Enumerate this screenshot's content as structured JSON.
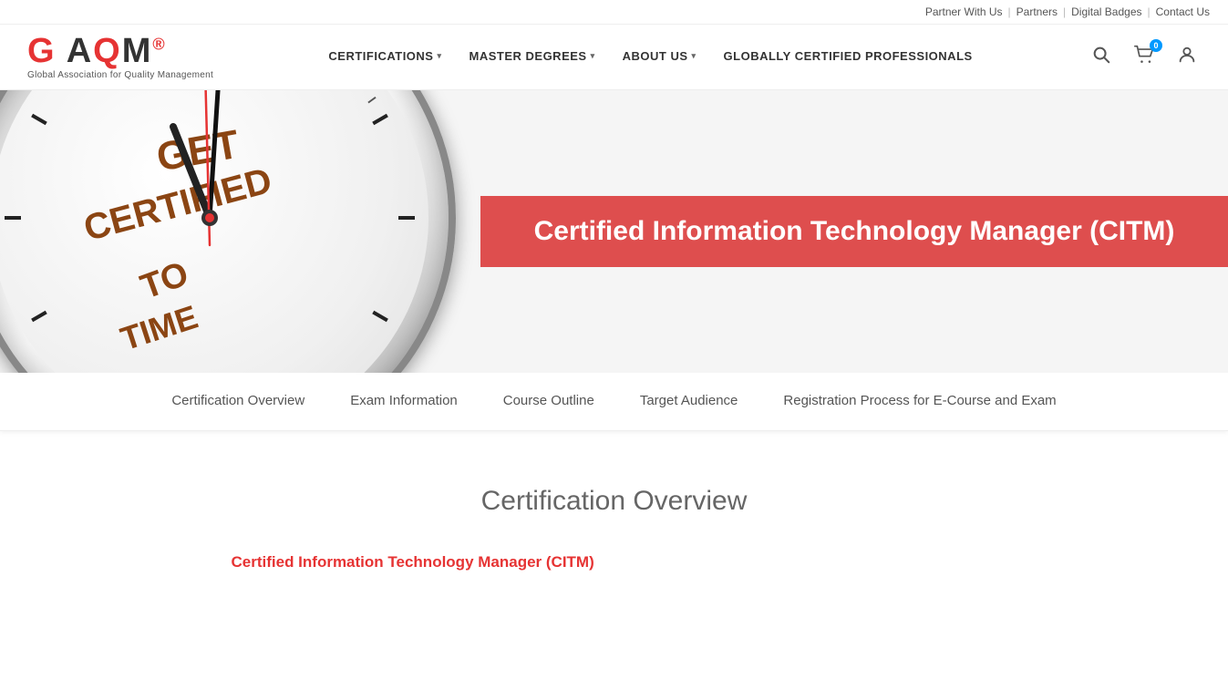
{
  "topbar": {
    "links": [
      {
        "label": "Partner With Us",
        "id": "partner-with-us"
      },
      {
        "label": "Partners",
        "id": "partners"
      },
      {
        "label": "Digital Badges",
        "id": "digital-badges"
      },
      {
        "label": "Contact Us",
        "id": "contact-us"
      }
    ]
  },
  "logo": {
    "text": "GAQM",
    "subtitle": "Global Association for Quality Management",
    "registered_mark": "®"
  },
  "nav": {
    "items": [
      {
        "label": "CERTIFICATIONS",
        "has_dropdown": true,
        "id": "certifications"
      },
      {
        "label": "MASTER DEGREES",
        "has_dropdown": true,
        "id": "master-degrees"
      },
      {
        "label": "ABOUT US",
        "has_dropdown": true,
        "id": "about-us"
      },
      {
        "label": "GLOBALLY CERTIFIED PROFESSIONALS",
        "has_dropdown": false,
        "id": "globally-certified"
      }
    ]
  },
  "cart": {
    "count": "0"
  },
  "hero": {
    "title": "Certified Information Technology Manager (CITM)",
    "clock_alt": "Time To Get Certified clock"
  },
  "tabs": {
    "items": [
      {
        "label": "Certification Overview",
        "id": "certification-overview",
        "active": false
      },
      {
        "label": "Exam Information",
        "id": "exam-information",
        "active": false
      },
      {
        "label": "Course Outline",
        "id": "course-outline",
        "active": false
      },
      {
        "label": "Target Audience",
        "id": "target-audience",
        "active": false
      },
      {
        "label": "Registration Process for E-Course and Exam",
        "id": "registration-process",
        "active": false
      }
    ]
  },
  "main": {
    "section_title": "Certification Overview",
    "cert_link_text": "Certified Information Technology Manager (CITM)"
  }
}
